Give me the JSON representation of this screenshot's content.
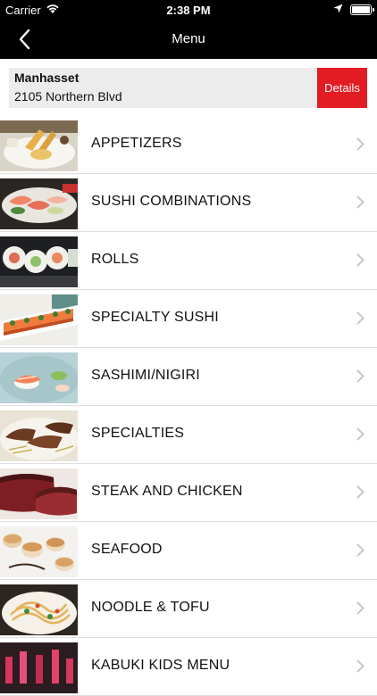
{
  "status_bar": {
    "carrier": "Carrier",
    "time": "2:38 PM",
    "icons": [
      "wifi-icon",
      "location-arrow-icon",
      "battery-icon"
    ]
  },
  "nav": {
    "title": "Menu",
    "back_icon": "chevron-left-icon"
  },
  "location": {
    "name": "Manhasset",
    "address": "2105 Northern Blvd",
    "details_label": "Details"
  },
  "menu": {
    "items": [
      {
        "label": "APPETIZERS",
        "image": "tempura-plate-photo"
      },
      {
        "label": "SUSHI COMBINATIONS",
        "image": "sashimi-platter-photo"
      },
      {
        "label": "ROLLS",
        "image": "sushi-rolls-photo"
      },
      {
        "label": "SPECIALTY SUSHI",
        "image": "specialty-roll-photo"
      },
      {
        "label": "SASHIMI/NIGIRI",
        "image": "nigiri-photo"
      },
      {
        "label": "SPECIALTIES",
        "image": "sliced-steak-photo"
      },
      {
        "label": "STEAK AND CHICKEN",
        "image": "steak-photo"
      },
      {
        "label": "SEAFOOD",
        "image": "scallops-photo"
      },
      {
        "label": "NOODLE & TOFU",
        "image": "noodles-photo"
      },
      {
        "label": "KABUKI KIDS MENU",
        "image": "kids-menu-photo"
      }
    ]
  },
  "colors": {
    "bars": "#000000",
    "details_button": "#e31b23",
    "location_bg": "#ececec",
    "chevron": "#c7c7cc"
  }
}
